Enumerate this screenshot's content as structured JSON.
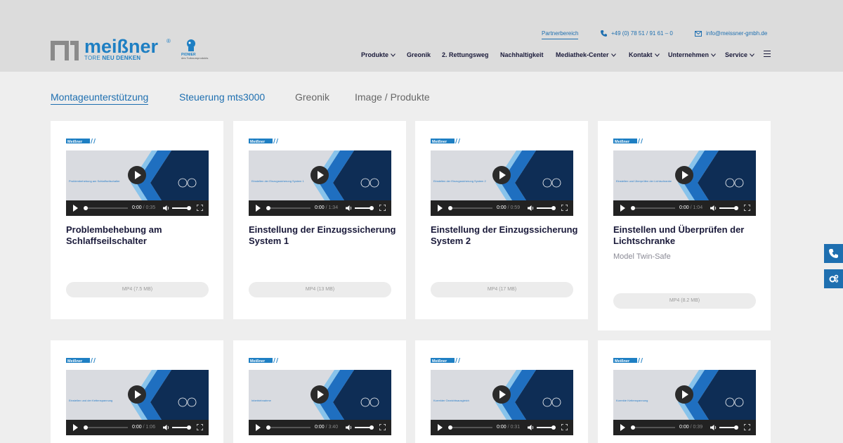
{
  "brand": {
    "name": "meißner",
    "tagline_prefix": "TORE ",
    "tagline_bold": "NEU DENKEN",
    "pionier_title": "PIONIER",
    "pionier_sub": "des Torbaumprodukts"
  },
  "topbar": {
    "partner": "Partnerbereich",
    "phone": "+49 (0) 78 51 / 91 61 – 0",
    "email": "info@meissner-gmbh.de"
  },
  "nav": {
    "items": [
      {
        "label": "Produkte",
        "dropdown": true
      },
      {
        "label": "Greonik",
        "dropdown": false
      },
      {
        "label": "2. Rettungsweg",
        "dropdown": false
      },
      {
        "label": "Nachhaltigkeit",
        "dropdown": false
      },
      {
        "label": "Mediathek-Center",
        "dropdown": true
      },
      {
        "label": "Kontakt",
        "dropdown": true
      },
      {
        "label": "Unternehmen",
        "dropdown": true
      },
      {
        "label": "Service",
        "dropdown": true
      }
    ]
  },
  "tabs": [
    {
      "label": "Montageunterstützung",
      "state": "active"
    },
    {
      "label": "Steuerung mts3000",
      "state": "link"
    },
    {
      "label": "Greonik",
      "state": "inactive"
    },
    {
      "label": "Image / Produkte",
      "state": "inactive"
    }
  ],
  "cards": [
    {
      "title": "Problembehebung am Schlaffseilschalter",
      "subtitle": "",
      "download": "MP4 (7.5 MB)",
      "time": "0:00",
      "duration": "/ 0:35",
      "video_text": "Problembehebung am Schlaffseilschalter"
    },
    {
      "title": "Einstellung der Einzugssicherung System 1",
      "subtitle": "",
      "download": "MP4 (13 MB)",
      "time": "0:00",
      "duration": "/ 1:34",
      "video_text": "Einstellen der Einzugssicherung System 1"
    },
    {
      "title": "Einstellung der Einzugssicherung System 2",
      "subtitle": "",
      "download": "MP4 (17 MB)",
      "time": "0:00",
      "duration": "/ 0:59",
      "video_text": "Einstellen der Einzugssicherung System 2"
    },
    {
      "title": "Einstellen und Überprüfen der Lichtschranke",
      "subtitle": "Model Twin-Safe",
      "download": "MP4 (8.2 MB)",
      "time": "0:00",
      "duration": "/ 1:04",
      "video_text": "Einstellen und Überprüfen der Lichtschranke"
    },
    {
      "title": "",
      "subtitle": "",
      "download": "",
      "time": "0:00",
      "duration": "/ 1:06",
      "video_text": "Einstellen und der Kettenspannung"
    },
    {
      "title": "",
      "subtitle": "",
      "download": "",
      "time": "0:00",
      "duration": "/ 3:40",
      "video_text": "Inbetriebnahme"
    },
    {
      "title": "",
      "subtitle": "",
      "download": "",
      "time": "0:00",
      "duration": "/ 0:31",
      "video_text": "Korrekter Gewichtsausgleich"
    },
    {
      "title": "",
      "subtitle": "",
      "download": "",
      "time": "0:00",
      "duration": "/ 0:39",
      "video_text": "Korrekte Kettenspannung"
    }
  ],
  "colors": {
    "accent": "#1e6fb0",
    "header_bg": "#dcdcdc",
    "page_bg": "#eeeeee",
    "video_dark": "#0e2d55"
  },
  "side_buttons": [
    {
      "icon": "phone-icon"
    },
    {
      "icon": "settings-icon"
    }
  ]
}
